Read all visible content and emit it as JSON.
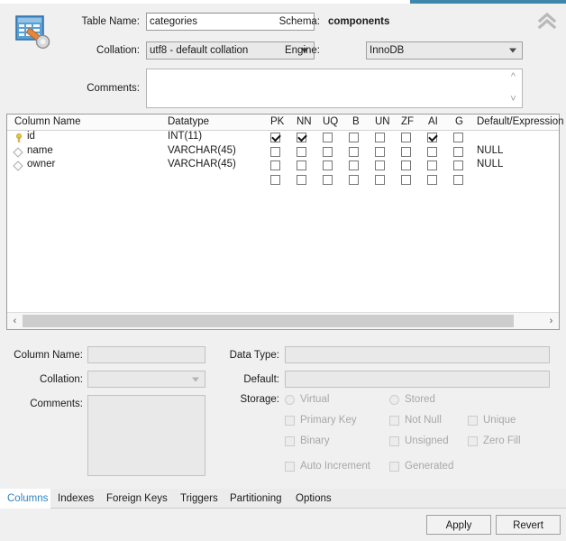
{
  "header": {
    "table_name_label": "Table Name:",
    "table_name_value": "categories",
    "schema_label": "Schema:",
    "schema_value": "components",
    "collation_label": "Collation:",
    "collation_value": "utf8 - default collation",
    "engine_label": "Engine:",
    "engine_value": "InnoDB",
    "comments_label": "Comments:",
    "comments_value": "",
    "collapse_icon": "double-chevron-up-icon",
    "table_icon": "table-editor-icon"
  },
  "grid": {
    "headers": {
      "column_name": "Column Name",
      "datatype": "Datatype",
      "pk": "PK",
      "nn": "NN",
      "uq": "UQ",
      "b": "B",
      "un": "UN",
      "zf": "ZF",
      "ai": "AI",
      "g": "G",
      "default": "Default/Expression"
    },
    "rows": [
      {
        "icon": "primary-key-icon",
        "name": "id",
        "datatype": "INT(11)",
        "pk": true,
        "nn": true,
        "uq": false,
        "b": false,
        "un": false,
        "zf": false,
        "ai": true,
        "g": false,
        "default": ""
      },
      {
        "icon": "column-diamond-icon",
        "name": "name",
        "datatype": "VARCHAR(45)",
        "pk": false,
        "nn": false,
        "uq": false,
        "b": false,
        "un": false,
        "zf": false,
        "ai": false,
        "g": false,
        "default": "NULL"
      },
      {
        "icon": "column-diamond-icon",
        "name": "owner",
        "datatype": "VARCHAR(45)",
        "pk": false,
        "nn": false,
        "uq": false,
        "b": false,
        "un": false,
        "zf": false,
        "ai": false,
        "g": false,
        "default": "NULL"
      },
      {
        "icon": "none",
        "name": "",
        "datatype": "",
        "pk": false,
        "nn": false,
        "uq": false,
        "b": false,
        "un": false,
        "zf": false,
        "ai": false,
        "g": false,
        "default": ""
      }
    ],
    "scroll_left_icon": "chevron-left-icon",
    "scroll_right_icon": "chevron-right-icon"
  },
  "detail": {
    "column_name_label": "Column Name:",
    "column_name_value": "",
    "collation_label": "Collation:",
    "collation_value": "",
    "comments_label": "Comments:",
    "comments_value": "",
    "data_type_label": "Data Type:",
    "data_type_value": "",
    "default_label": "Default:",
    "default_value": "",
    "storage_label": "Storage:",
    "options": [
      {
        "type": "radio",
        "label": "Virtual",
        "checked": false
      },
      {
        "type": "radio",
        "label": "Stored",
        "checked": false
      },
      {
        "type": "checkbox",
        "label": "Primary Key",
        "checked": false
      },
      {
        "type": "checkbox",
        "label": "Not Null",
        "checked": false
      },
      {
        "type": "checkbox",
        "label": "Unique",
        "checked": false
      },
      {
        "type": "checkbox",
        "label": "Binary",
        "checked": false
      },
      {
        "type": "checkbox",
        "label": "Unsigned",
        "checked": false
      },
      {
        "type": "checkbox",
        "label": "Zero Fill",
        "checked": false
      },
      {
        "type": "checkbox",
        "label": "Auto Increment",
        "checked": false
      },
      {
        "type": "checkbox",
        "label": "Generated",
        "checked": false
      }
    ]
  },
  "tabs": [
    {
      "label": "Columns",
      "active": true
    },
    {
      "label": "Indexes",
      "active": false
    },
    {
      "label": "Foreign Keys",
      "active": false
    },
    {
      "label": "Triggers",
      "active": false
    },
    {
      "label": "Partitioning",
      "active": false
    },
    {
      "label": "Options",
      "active": false
    }
  ],
  "footer": {
    "apply_label": "Apply",
    "revert_label": "Revert"
  },
  "colors": {
    "accent": "#3d87ab",
    "active_tab_text": "#2f84c4",
    "key_yellow": "#e8c547"
  }
}
